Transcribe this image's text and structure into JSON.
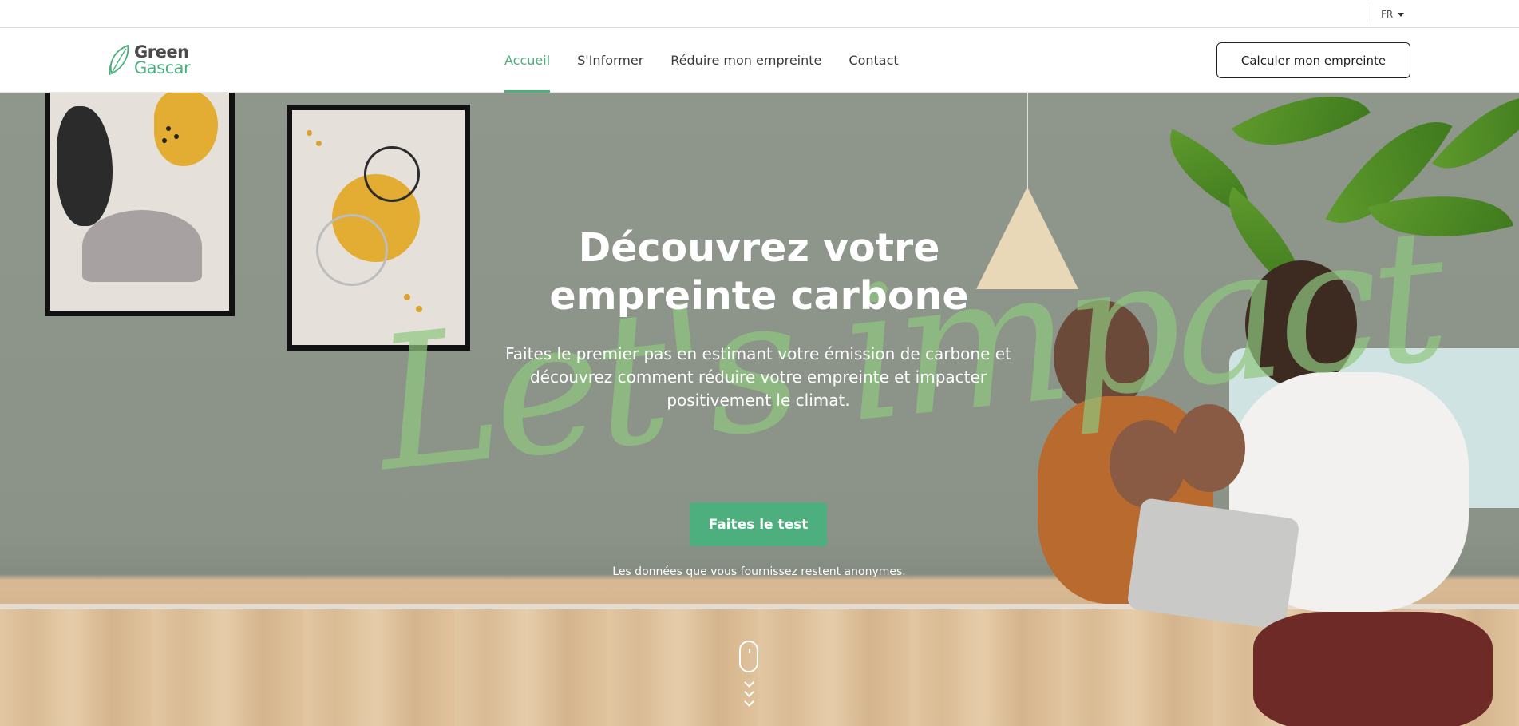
{
  "topbar": {
    "language": "FR"
  },
  "header": {
    "logo": {
      "line1": "Green",
      "line2": "Gascar"
    },
    "nav": [
      {
        "label": "Accueil",
        "active": true
      },
      {
        "label": "S'Informer",
        "active": false
      },
      {
        "label": "Réduire mon empreinte",
        "active": false
      },
      {
        "label": "Contact",
        "active": false
      }
    ],
    "cta_label": "Calculer mon empreinte"
  },
  "hero": {
    "title_line1": "Découvrez votre",
    "title_line2": "empreinte carbone",
    "subtitle": "Faites le premier pas en estimant votre émission de carbone et découvrez comment réduire votre empreinte et impacter positivement le climat.",
    "script_text": "Let's impact",
    "button_label": "Faites le test",
    "note": "Les données que vous fournissez restent anonymes."
  },
  "colors": {
    "accent": "#4caf7d",
    "hero_wall": "#8f978d",
    "text_dark": "#2a2a2a"
  },
  "icons": {
    "logo": "leaf-icon",
    "language_caret": "caret-down-icon",
    "scroll": "mouse-scroll-icon"
  }
}
